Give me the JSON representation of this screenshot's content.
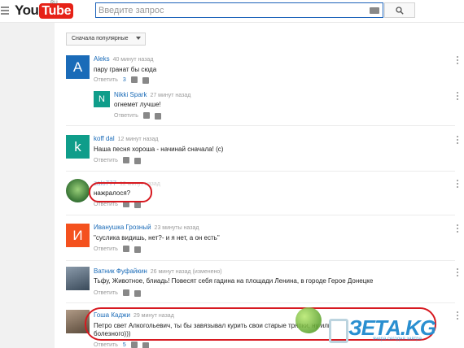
{
  "header": {
    "logo_you": "You",
    "logo_tube": "Tube",
    "logo_region": "RU",
    "search_placeholder": "Введите запрос"
  },
  "sort": {
    "label": "Сначала популярные"
  },
  "comments": [
    {
      "author": "Aleks",
      "time": "40 минут назад",
      "text": "пару гранат бы сюда",
      "reply_label": "Ответить",
      "reply_count": "3",
      "avatar_letter": "A",
      "avatar_color": "#1a6bb8"
    },
    {
      "author": "Nikki Spark",
      "time": "27 минут назад",
      "text": "огнемет лучше!",
      "reply_label": "Ответить",
      "avatar_letter": "N",
      "avatar_color": "#0f9d8a"
    },
    {
      "author": "koff dal",
      "time": "12 минут назад",
      "text": "Наша песня хороша - начинай сначала! (с)",
      "reply_label": "Ответить",
      "avatar_letter": "k",
      "avatar_color": "#0f9d8a"
    },
    {
      "author": "zalo777",
      "time": "12 минут назад",
      "text": "нажралося?",
      "reply_label": "Ответить",
      "avatar_color": "#3b8f3b"
    },
    {
      "author": "Иванушка Грозный",
      "time": "23 минуты назад",
      "text": "\"суслика видишь, нет?- и я нет, а он есть\"",
      "reply_label": "Ответить",
      "avatar_letter": "И",
      "avatar_color": "#f4511e"
    },
    {
      "author": "Ватник Фуфайкин",
      "time": "26 минут назад",
      "edited": "(изменено)",
      "text": "Тьфу, Животное, блиадь! Повесят себя гадина на площади Ленина, в городе Герое Донецке",
      "reply_label": "Ответить",
      "avatar_color": "#5a6a7a"
    },
    {
      "author": "Гоша Каджи",
      "time": "29 минут назад",
      "text_line1": "Петро свет Алкогольевич, ты бы завязывал курить свои старые тряпки, ну или",
      "text_line2": "болезного)))",
      "reply_label": "Ответить",
      "reply_count": "5",
      "avatar_color": "#7a6a5a"
    }
  ],
  "watermark": {
    "brand": "ЗЕТА.KG",
    "tagline": "ячера сегодня завтра"
  }
}
